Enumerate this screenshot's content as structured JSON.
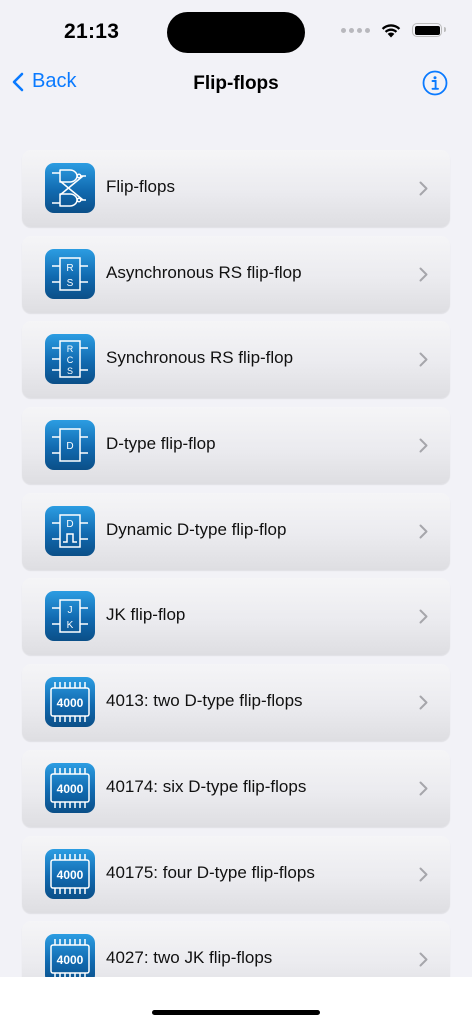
{
  "status": {
    "time": "21:13"
  },
  "nav": {
    "back_label": "Back",
    "title": "Flip-flops"
  },
  "colors": {
    "accent": "#0a7aff",
    "icon_top": "#2c9de2",
    "icon_bottom": "#0b4f88"
  },
  "items": [
    {
      "label": "Flip-flops",
      "icon": "flip-flop-gates-icon"
    },
    {
      "label": "Asynchronous RS flip-flop",
      "icon": "rs-block-icon"
    },
    {
      "label": "Synchronous RS flip-flop",
      "icon": "rcs-block-icon"
    },
    {
      "label": "D-type flip-flop",
      "icon": "d-block-icon"
    },
    {
      "label": "Dynamic D-type flip-flop",
      "icon": "dynamic-d-block-icon"
    },
    {
      "label": "JK flip-flop",
      "icon": "jk-block-icon"
    },
    {
      "label": "4013: two D-type flip-flops",
      "icon": "chip-4000-icon",
      "chip_text": "4000"
    },
    {
      "label": "40174: six D-type flip-flops",
      "icon": "chip-4000-icon",
      "chip_text": "4000"
    },
    {
      "label": "40175: four D-type flip-flops",
      "icon": "chip-4000-icon",
      "chip_text": "4000"
    },
    {
      "label": "4027: two JK flip-flops",
      "icon": "chip-4000-icon",
      "chip_text": "4000"
    }
  ],
  "block_letters": {
    "rs": [
      "R",
      "S"
    ],
    "rcs": [
      "R",
      "C",
      "S"
    ],
    "d": [
      "D"
    ],
    "jk": [
      "J",
      "K"
    ]
  }
}
